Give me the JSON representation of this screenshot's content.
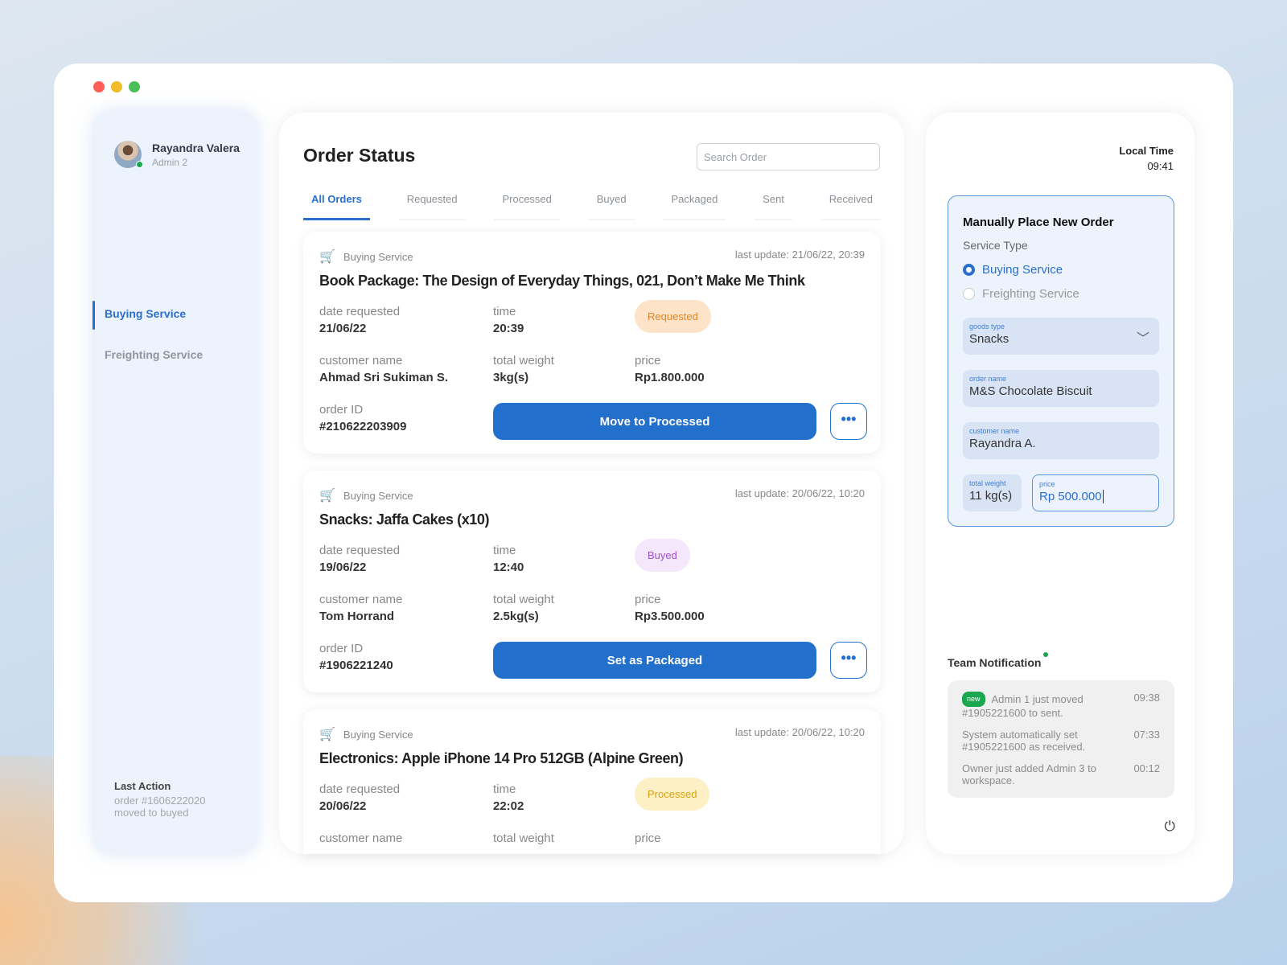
{
  "window": {
    "traffic_lights": [
      "#ff5f57",
      "#f1bb2c",
      "#4cbf5a"
    ]
  },
  "sidebar": {
    "user_name": "Rayandra Valera",
    "user_role": "Admin 2",
    "items": [
      {
        "label": "Buying Service"
      },
      {
        "label": "Freighting Service"
      }
    ],
    "last_action": {
      "title": "Last Action",
      "line1": "order #1606222020",
      "line2": "moved to buyed"
    }
  },
  "main": {
    "title": "Order Status",
    "search_placeholder": "Search Order",
    "tabs": [
      {
        "label": "All Orders"
      },
      {
        "label": "Requested"
      },
      {
        "label": "Processed"
      },
      {
        "label": "Buyed"
      },
      {
        "label": "Packaged"
      },
      {
        "label": "Sent"
      },
      {
        "label": "Received"
      }
    ],
    "labels": {
      "date": "date requested",
      "time": "time",
      "customer": "customer name",
      "weight": "total weight",
      "price": "price",
      "order_id": "order ID",
      "more": "•••"
    },
    "orders": [
      {
        "service": "Buying Service",
        "updated": "last update: 21/06/22, 20:39",
        "title": "Book Package: The Design of Everyday Things, 021, Don’t Make Me Think",
        "date": "21/06/22",
        "time": "20:39",
        "status": "Requested",
        "customer": "Ahmad Sri Sukiman S.",
        "weight": "3kg(s)",
        "price": "Rp1.800.000",
        "order_id": "#210622203909",
        "action": "Move to Processed"
      },
      {
        "service": "Buying Service",
        "updated": "last update: 20/06/22, 10:20",
        "title": "Snacks: Jaffa Cakes (x10)",
        "date": "19/06/22",
        "time": "12:40",
        "status": "Buyed",
        "customer": "Tom Horrand",
        "weight": "2.5kg(s)",
        "price": "Rp3.500.000",
        "order_id": "#1906221240",
        "action": "Set as Packaged"
      },
      {
        "service": "Buying Service",
        "updated": "last update: 20/06/22, 10:20",
        "title": "Electronics: Apple iPhone 14 Pro 512GB (Alpine Green)",
        "date": "20/06/22",
        "time": "22:02",
        "status": "Processed"
      }
    ]
  },
  "right": {
    "local_time_label": "Local Time",
    "local_time": "09:41",
    "form": {
      "title": "Manually Place New Order",
      "service_type_label": "Service Type",
      "options": [
        "Buying Service",
        "Freighting Service"
      ],
      "goods_type_label": "goods type",
      "goods_type": "Snacks",
      "order_name_label": "order name",
      "order_name": "M&S Chocolate Biscuit",
      "customer_label": "customer name",
      "customer": "Rayandra A.",
      "weight_label": "total weight",
      "weight": "11 kg(s)",
      "price_label": "price",
      "price": "Rp 500.000"
    },
    "notifications": {
      "title": "Team Notification",
      "new_badge": "new",
      "items": [
        {
          "text": "Admin 1 just moved #1905221600 to sent.",
          "time": "09:38"
        },
        {
          "text": "System automatically set #1905221600 as received.",
          "time": "07:33"
        },
        {
          "text": "Owner just added Admin 3 to workspace.",
          "time": "00:12"
        }
      ]
    }
  }
}
